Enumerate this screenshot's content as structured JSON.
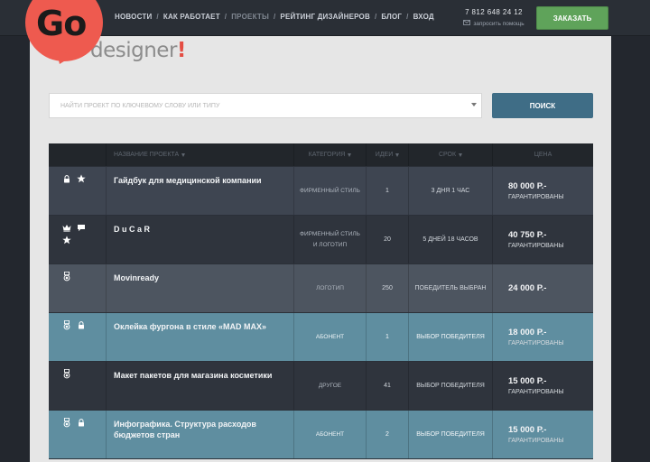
{
  "logo": {
    "text": "Go",
    "tagline": "designer",
    "tagline_mark": "!"
  },
  "nav": {
    "items": [
      {
        "label": "НОВОСТИ",
        "active": false
      },
      {
        "label": "КАК РАБОТАЕТ",
        "active": false
      },
      {
        "label": "ПРОЕКТЫ",
        "active": true
      },
      {
        "label": "РЕЙТИНГ ДИЗАЙНЕРОВ",
        "active": false
      },
      {
        "label": "БЛОГ",
        "active": false
      },
      {
        "label": "ВХОД",
        "active": false
      }
    ],
    "separator": "/"
  },
  "contact": {
    "phone": "7 812 648 24 12",
    "callback_label": "запросить помощь"
  },
  "order_button": {
    "label": "ЗАКАЗАТЬ"
  },
  "search": {
    "placeholder": "НАЙТИ ПРОЕКТ ПО КЛЮЧЕВОМУ СЛОВУ ИЛИ ТИПУ",
    "button_label": "ПОИСК"
  },
  "table": {
    "columns": {
      "name": "НАЗВАНИЕ ПРОЕКТА",
      "category": "КАТЕГОРИЯ",
      "ideas": "ИДЕИ",
      "term": "СРОК",
      "price": "ЦЕНА"
    },
    "rows": [
      {
        "icons": [
          "lock-icon",
          "star-icon"
        ],
        "name": "Гайдбук для медицинской компании",
        "category": "ФИРМЕННЫЙ СТИЛЬ",
        "ideas": "1",
        "term": "3 ДНЯ 1 ЧАС",
        "price": "80 000 Р.-",
        "guarantee": "ГАРАНТИРОВАНЫ",
        "style": "r-a"
      },
      {
        "icons": [
          "crown-icon",
          "chat-icon",
          "star-icon"
        ],
        "name": "D u C a R",
        "category": "ФИРМЕННЫЙ СТИЛЬ И ЛОГОТИП",
        "ideas": "20",
        "term": "5 ДНЕЙ 18 ЧАСОВ",
        "price": "40 750 Р.-",
        "guarantee": "ГАРАНТИРОВАНЫ",
        "style": "r-b"
      },
      {
        "icons": [
          "medal-icon"
        ],
        "name": "Movinready",
        "category": "ЛОГОТИП",
        "ideas": "250",
        "term": "ПОБЕДИТЕЛЬ ВЫБРАН",
        "price": "24 000 Р.-",
        "guarantee": "",
        "style": "r-c"
      },
      {
        "icons": [
          "medal-icon",
          "lock-icon"
        ],
        "name": "Оклейка фургона в стиле «MAD MAX»",
        "category": "АБОНЕНТ",
        "ideas": "1",
        "term": "ВЫБОР ПОБЕДИТЕЛЯ",
        "price": "18 000 Р.-",
        "guarantee": "ГАРАНТИРОВАНЫ",
        "style": "r-d"
      },
      {
        "icons": [
          "medal-icon"
        ],
        "name": "Макет пакетов для магазина косметики",
        "category": "ДРУГОЕ",
        "ideas": "41",
        "term": "ВЫБОР ПОБЕДИТЕЛЯ",
        "price": "15 000 Р.-",
        "guarantee": "ГАРАНТИРОВАНЫ",
        "style": "r-b"
      },
      {
        "icons": [
          "medal-icon",
          "lock-icon"
        ],
        "name": "Инфографика. Структура расходов бюджетов стран",
        "category": "АБОНЕНТ",
        "ideas": "2",
        "term": "ВЫБОР ПОБЕДИТЕЛЯ",
        "price": "15 000 Р.-",
        "guarantee": "ГАРАНТИРОВАНЫ",
        "style": "r-d"
      }
    ]
  },
  "colors": {
    "accent": "#ee5a4f",
    "order_green": "#5fa35a",
    "search_blue": "#3f6d86",
    "highlight_row": "#5f8ea0"
  }
}
